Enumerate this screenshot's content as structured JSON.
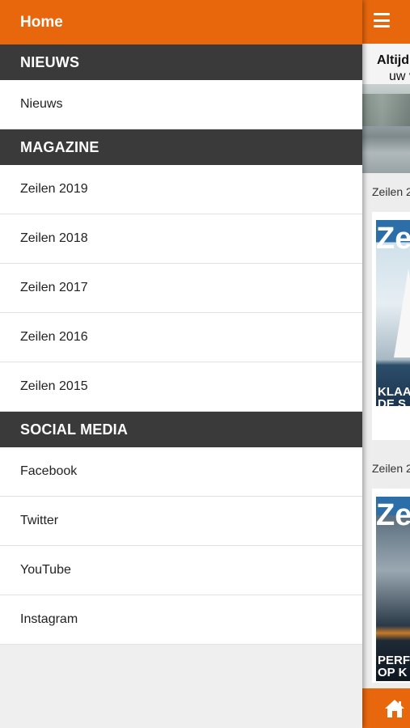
{
  "drawer": {
    "home_label": "Home",
    "sections": [
      {
        "title": "NIEUWS",
        "items": [
          "Nieuws"
        ]
      },
      {
        "title": "MAGAZINE",
        "items": [
          "Zeilen 2019",
          "Zeilen 2018",
          "Zeilen 2017",
          "Zeilen 2016",
          "Zeilen 2015"
        ]
      },
      {
        "title": "SOCIAL MEDIA",
        "items": [
          "Facebook",
          "Twitter",
          "YouTube",
          "Instagram"
        ]
      }
    ]
  },
  "main": {
    "menu_icon": "hamburger-menu-icon",
    "banner": {
      "line1": "Altijd",
      "line2": "uw v"
    },
    "issues": [
      {
        "label": "Zeilen 2",
        "cover_logo": "Ze",
        "cover_title_1": "KLAA",
        "cover_title_2": "DE S"
      },
      {
        "label": "Zeilen 2",
        "cover_logo": "Ze",
        "cover_title_1": "PERF",
        "cover_title_2": "OP K"
      }
    ],
    "home_icon": "home-icon"
  },
  "colors": {
    "accent": "#e8670d",
    "section_header": "#3a3a3a",
    "background": "#efefef"
  }
}
